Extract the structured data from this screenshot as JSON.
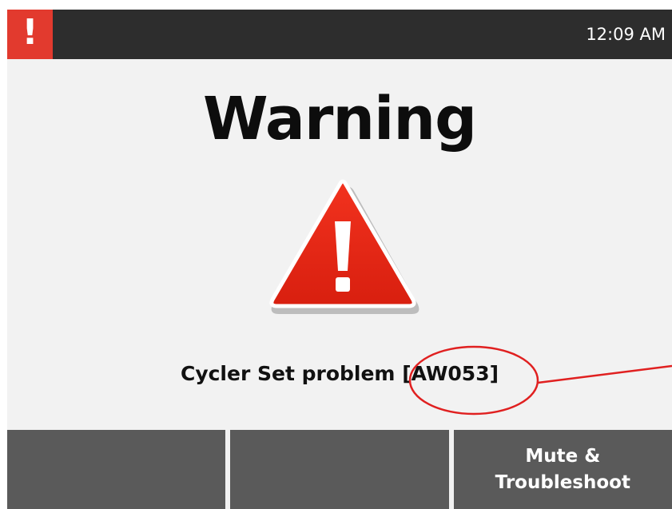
{
  "status_bar": {
    "alert_icon": "!",
    "time": "12:09 AM"
  },
  "screen": {
    "title": "Warning",
    "warning_icon": "warning-triangle-icon",
    "message_prefix": "Cycler Set problem ",
    "error_code": "[AW053]"
  },
  "buttons": {
    "left_label": "",
    "middle_label": "",
    "right_label_line1": "Mute &",
    "right_label_line2": "Troubleshoot"
  },
  "colors": {
    "alert_red": "#e23a2e",
    "bar_dark": "#2d2d2d",
    "button_gray": "#5a5a5a",
    "annotation_red": "#e02020"
  }
}
